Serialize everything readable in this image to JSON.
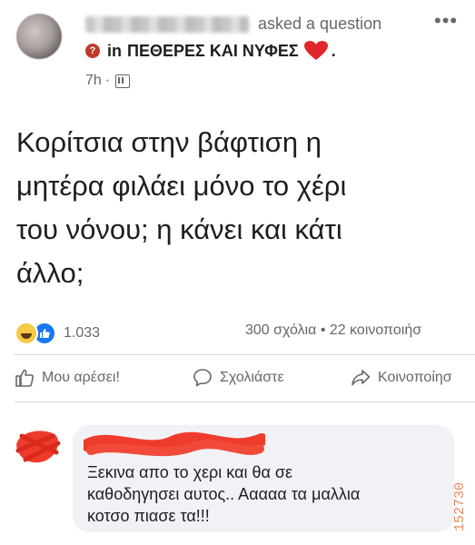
{
  "header": {
    "asked_text": "asked a question",
    "more_icon": "more-dots-icon",
    "in_label": "in",
    "group_name": "ΠΕΘΕΡΕΣ ΚΑΙ ΝΥΦΕΣ",
    "group_suffix": ".",
    "time": "7h",
    "time_separator": "·",
    "audience_icon": "group-audience-icon"
  },
  "post": {
    "text": "Κορίτσια στην βάφτιση η\nμητέρα φιλάει μόνο το χέρι\nτου νόνου; η κάνει και κάτι\nάλλο;"
  },
  "stats": {
    "reaction_count": "1.033",
    "comments_shares": "300 σχόλια • 22 κοινοποιήσ"
  },
  "actions": {
    "like": "Μου αρέσει!",
    "comment": "Σχολιάστε",
    "share": "Κοινοποίησ"
  },
  "comment": {
    "text": "Ξεκινα απο το χερι και θα σε\nκαθοδηγησει αυτος.. Ααααα τα μαλλια\nκοτσο πιασε τα!!!"
  },
  "watermark": "152730",
  "colors": {
    "accent_blue": "#1877f2",
    "secondary_text": "#65676b",
    "heart_red": "#e0262a",
    "scribble_red": "#ef3b2c",
    "comment_bg": "#f0f2f5"
  }
}
